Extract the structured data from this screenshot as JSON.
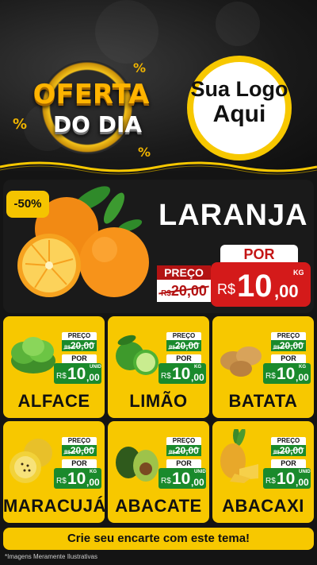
{
  "header": {
    "oferta_line1": "OFERTA",
    "oferta_line2": "DO DIA",
    "percent_symbol": "%",
    "logo_line1": "Sua Logo",
    "logo_line2": "Aqui"
  },
  "hero": {
    "discount": "-50%",
    "product": "LARANJA",
    "old_label": "PREÇO",
    "old_currency": "R$",
    "old_price": "20,00",
    "new_label": "POR",
    "new_currency": "R$",
    "new_int": "10",
    "new_dec": ",00",
    "unit": "KG"
  },
  "products": [
    {
      "name": "ALFACE",
      "old_label": "PREÇO",
      "old_currency": "R$",
      "old_price": "20,00",
      "new_label": "POR",
      "currency": "R$",
      "int": "10",
      "dec": ",00",
      "unit": "UNID"
    },
    {
      "name": "LIMÃO",
      "old_label": "PREÇO",
      "old_currency": "R$",
      "old_price": "20,00",
      "new_label": "POR",
      "currency": "R$",
      "int": "10",
      "dec": ",00",
      "unit": "KG"
    },
    {
      "name": "BATATA",
      "old_label": "PREÇO",
      "old_currency": "R$",
      "old_price": "20,00",
      "new_label": "POR",
      "currency": "R$",
      "int": "10",
      "dec": ",00",
      "unit": "KG"
    },
    {
      "name": "MARACUJÁ",
      "old_label": "PREÇO",
      "old_currency": "R$",
      "old_price": "20,00",
      "new_label": "POR",
      "currency": "R$",
      "int": "10",
      "dec": ",00",
      "unit": "KG"
    },
    {
      "name": "ABACATE",
      "old_label": "PREÇO",
      "old_currency": "R$",
      "old_price": "20,00",
      "new_label": "POR",
      "currency": "R$",
      "int": "10",
      "dec": ",00",
      "unit": "UNID"
    },
    {
      "name": "ABACAXI",
      "old_label": "PREÇO",
      "old_currency": "R$",
      "old_price": "20,00",
      "new_label": "POR",
      "currency": "R$",
      "int": "10",
      "dec": ",00",
      "unit": "UNID"
    }
  ],
  "footer": {
    "cta": "Crie seu encarte com este tema!",
    "disclaimer": "*Imagens Meramente Ilustrativas"
  },
  "colors": {
    "yellow": "#f7c800",
    "red": "#d41a1a",
    "green": "#1a8a2c",
    "dark": "#141414"
  }
}
